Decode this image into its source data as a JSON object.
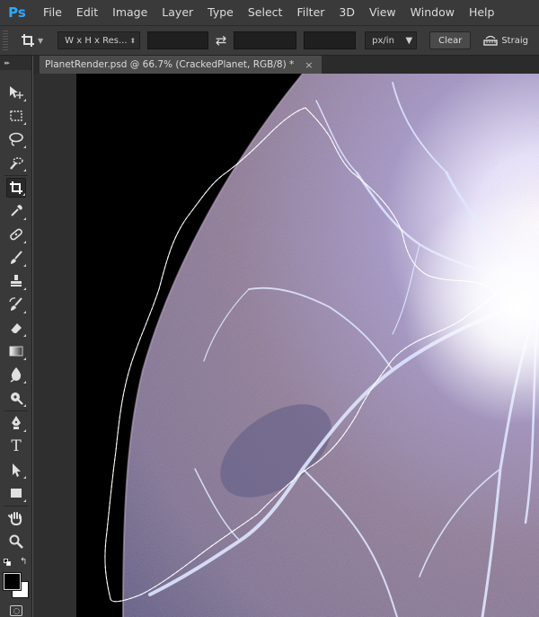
{
  "app": {
    "logo": "Ps"
  },
  "menu": [
    "File",
    "Edit",
    "Image",
    "Layer",
    "Type",
    "Select",
    "Filter",
    "3D",
    "View",
    "Window",
    "Help"
  ],
  "options": {
    "preset_icon": "crop-icon",
    "ratio_select": "W x H x Res...",
    "width_value": "",
    "height_value": "",
    "resolution_value": "",
    "unit_select": "px/in",
    "clear_label": "Clear",
    "straighten_label": "Straig"
  },
  "toolbar": {
    "tools": [
      "move-icon",
      "marquee-icon",
      "lasso-icon",
      "quick-selection-icon",
      "crop-icon",
      "eyedropper-icon",
      "healing-brush-icon",
      "brush-icon",
      "clone-stamp-icon",
      "history-brush-icon",
      "eraser-icon",
      "gradient-icon",
      "blur-icon",
      "dodge-icon",
      "pen-icon",
      "type-icon",
      "path-selection-icon",
      "rectangle-icon",
      "hand-icon",
      "zoom-icon"
    ],
    "active_tool": "crop-icon",
    "type_glyph": "T"
  },
  "document": {
    "tab_title": "PlanetRender.psd @ 66.7% (CrackedPlanet, RGB/8) *",
    "close": "×"
  },
  "colors": {
    "menu_bg": "#3a3a3a",
    "toolbar_bg": "#393939",
    "canvas_bg": "#000000",
    "planet_base": "#8a7f9a",
    "planet_glow": "#ffffff",
    "crack_color": "#d8e2ff"
  }
}
